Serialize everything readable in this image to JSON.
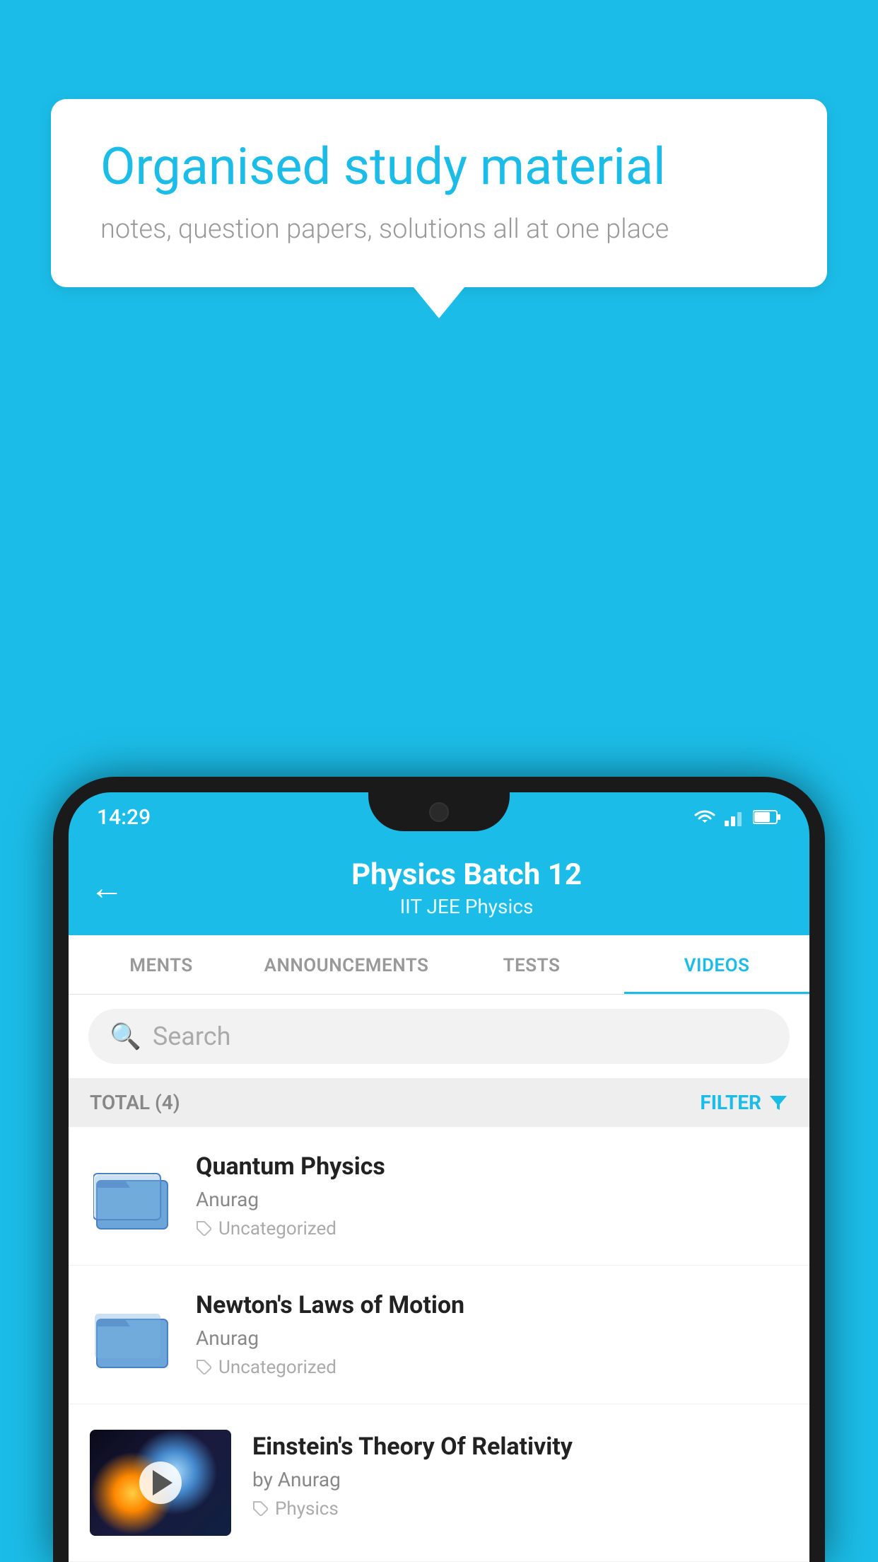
{
  "background": {
    "color": "#1BBDE8"
  },
  "speech_bubble": {
    "title": "Organised study material",
    "subtitle": "notes, question papers, solutions all at one place"
  },
  "phone": {
    "status_bar": {
      "time": "14:29"
    },
    "header": {
      "title": "Physics Batch 12",
      "subtitle": "IIT JEE   Physics",
      "back_label": "←"
    },
    "tabs": [
      {
        "label": "MENTS",
        "active": false
      },
      {
        "label": "ANNOUNCEMENTS",
        "active": false
      },
      {
        "label": "TESTS",
        "active": false
      },
      {
        "label": "VIDEOS",
        "active": true
      }
    ],
    "search": {
      "placeholder": "Search"
    },
    "filter_bar": {
      "total_label": "TOTAL (4)",
      "filter_label": "FILTER"
    },
    "videos": [
      {
        "title": "Quantum Physics",
        "author": "Anurag",
        "tag": "Uncategorized",
        "type": "folder"
      },
      {
        "title": "Newton's Laws of Motion",
        "author": "Anurag",
        "tag": "Uncategorized",
        "type": "folder"
      },
      {
        "title": "Einstein's Theory Of Relativity",
        "author": "by Anurag",
        "tag": "Physics",
        "type": "video"
      }
    ]
  }
}
